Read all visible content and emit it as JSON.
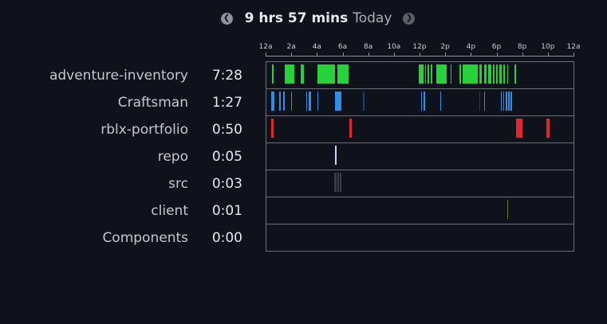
{
  "header": {
    "prev_icon": "chevron-left-icon",
    "next_icon": "chevron-right-icon",
    "duration": "9 hrs 57 mins",
    "period": "Today"
  },
  "axis": {
    "ticks": [
      "12a",
      "2a",
      "4a",
      "6a",
      "8a",
      "10a",
      "12p",
      "2p",
      "4p",
      "6p",
      "8p",
      "10p",
      "12a"
    ]
  },
  "projects": [
    {
      "name": "adventure-inventory",
      "time": "7:28",
      "color": "#27d13a",
      "segments": [
        [
          0.45,
          0.55
        ],
        [
          1.45,
          2.15
        ],
        [
          2.65,
          2.95
        ],
        [
          4.0,
          4.05
        ],
        [
          4.1,
          5.35
        ],
        [
          5.55,
          5.7
        ],
        [
          5.75,
          6.4
        ],
        [
          11.85,
          12.25
        ],
        [
          12.35,
          12.45
        ],
        [
          12.55,
          12.7
        ],
        [
          12.8,
          12.95
        ],
        [
          13.25,
          14.05
        ],
        [
          14.35,
          14.45
        ],
        [
          15.05,
          15.15
        ],
        [
          15.3,
          16.5
        ],
        [
          16.6,
          16.8
        ],
        [
          17.0,
          17.15
        ],
        [
          17.3,
          17.55
        ],
        [
          17.65,
          17.8
        ],
        [
          17.9,
          18.05
        ],
        [
          18.15,
          18.35
        ],
        [
          18.45,
          18.6
        ],
        [
          18.75,
          18.85
        ],
        [
          19.35,
          19.45
        ]
      ],
      "faint": []
    },
    {
      "name": "Craftsman",
      "time": "1:27",
      "color": "#2f8ee6",
      "segments": [
        [
          0.4,
          0.65
        ],
        [
          1.0,
          1.05
        ],
        [
          1.3,
          1.45
        ],
        [
          1.9,
          2.0
        ],
        [
          3.1,
          3.15
        ],
        [
          3.3,
          3.5
        ],
        [
          3.95,
          4.05
        ],
        [
          5.35,
          5.45
        ],
        [
          5.5,
          5.85
        ],
        [
          12.05,
          12.1
        ],
        [
          12.25,
          12.3
        ],
        [
          13.55,
          13.6
        ],
        [
          16.95,
          17.0
        ],
        [
          18.25,
          18.3
        ],
        [
          18.45,
          18.55
        ],
        [
          18.65,
          18.75
        ],
        [
          18.85,
          18.95
        ],
        [
          19.05,
          19.15
        ]
      ],
      "faint": [
        [
          7.55,
          7.6
        ],
        [
          16.6,
          16.65
        ]
      ]
    },
    {
      "name": "rblx-portfolio",
      "time": "0:50",
      "color": "#e0262f",
      "segments": [
        [
          0.4,
          0.55
        ],
        [
          6.45,
          6.65
        ],
        [
          19.45,
          19.95
        ],
        [
          21.85,
          22.1
        ]
      ],
      "faint": []
    },
    {
      "name": "repo",
      "time": "0:05",
      "color": "#c8d6ff",
      "segments": [
        [
          5.35,
          5.45
        ]
      ],
      "faint": []
    },
    {
      "name": "src",
      "time": "0:03",
      "color": "#3a3d45",
      "segments": [
        [
          5.3,
          5.45
        ],
        [
          5.55,
          5.65
        ],
        [
          5.75,
          5.85
        ]
      ],
      "faint": []
    },
    {
      "name": "client",
      "time": "0:01",
      "color": "#6b7a2a",
      "segments": [
        [
          18.75,
          18.85
        ]
      ],
      "faint": []
    },
    {
      "name": "Components",
      "time": "0:00",
      "color": "#5f6470",
      "segments": [],
      "faint": []
    }
  ]
}
